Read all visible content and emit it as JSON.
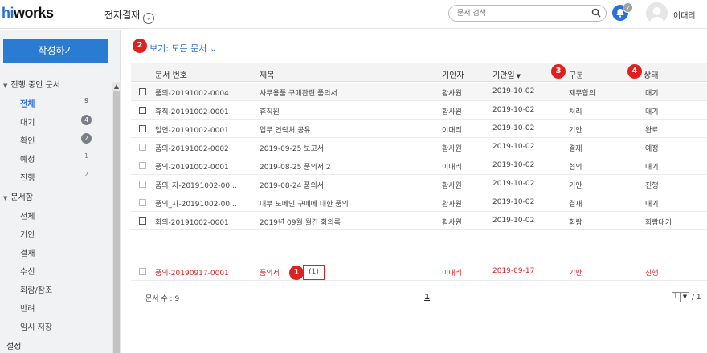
{
  "header": {
    "logo_prefix": "hi",
    "logo_rest": "works",
    "app_title": "전자결재",
    "search_placeholder": "문서 검색",
    "notification_count": "7",
    "user_name": "이대리"
  },
  "sidebar": {
    "write_button": "작성하기",
    "section_inprogress": "진행 중인 문서",
    "inprogress_items": [
      {
        "label": "전체",
        "count": "9"
      },
      {
        "label": "대기",
        "count": "4"
      },
      {
        "label": "확인",
        "count": "2"
      },
      {
        "label": "예정",
        "count": "1"
      },
      {
        "label": "진행",
        "count": "2"
      }
    ],
    "section_box": "문서함",
    "box_items": [
      "전체",
      "기안",
      "결재",
      "수신",
      "회람/참조",
      "반려",
      "임시 저장"
    ],
    "settings": "설정"
  },
  "main": {
    "view_selector": "보기: 모든 문서",
    "columns": {
      "doc_no": "문서 번호",
      "title": "제목",
      "drafter": "기안자",
      "date": "기안일",
      "type": "구분",
      "status": "상태"
    },
    "rows": [
      {
        "doc_no": "품의-20191002-0004",
        "title": "사무용품 구매관련 품의서",
        "drafter": "황사원",
        "date": "2019-10-02",
        "type": "재무합의",
        "status": "대기"
      },
      {
        "doc_no": "휴직-20191002-0001",
        "title": "휴직원",
        "drafter": "황사원",
        "date": "2019-10-02",
        "type": "처리",
        "status": "대기"
      },
      {
        "doc_no": "업연-20191002-0001",
        "title": "업무 연락처 공유",
        "drafter": "이대리",
        "date": "2019-10-02",
        "type": "기안",
        "status": "완료"
      },
      {
        "doc_no": "품의-20191002-0002",
        "title": "2019-09-25 보고서",
        "drafter": "황사원",
        "date": "2019-10-02",
        "type": "결재",
        "status": "예정"
      },
      {
        "doc_no": "품의-20191002-0001",
        "title": "2019-08-25 품의서 2",
        "drafter": "이대리",
        "date": "2019-10-02",
        "type": "협의",
        "status": "대기"
      },
      {
        "doc_no": "품의_자-20191002-00...",
        "title": "2019-08-24 품의서",
        "drafter": "황사원",
        "date": "2019-10-02",
        "type": "기안",
        "status": "진행"
      },
      {
        "doc_no": "품의_자-20191002-00...",
        "title": "내부 도메인 구매에 대한 품의",
        "drafter": "황사원",
        "date": "2019-10-02",
        "type": "결재",
        "status": "대기"
      },
      {
        "doc_no": "회의-20191002-0001",
        "title": "2019년 09월 월간 회의록",
        "drafter": "황사원",
        "date": "2019-10-02",
        "type": "회람",
        "status": "회람대기"
      },
      {
        "doc_no": "품의-20190917-0001",
        "title": "품의서",
        "drafter": "이대리",
        "date": "2019-09-17",
        "type": "기안",
        "status": "진행"
      }
    ],
    "attachment_count": "(1)",
    "markers": [
      "1",
      "2",
      "3",
      "4"
    ],
    "doc_count": "문서 수 : 9",
    "page": "1",
    "page_select": "1",
    "page_total": "/ 1"
  },
  "colors": {
    "accent": "#2a7bd2",
    "marker": "#e02020",
    "link": "#2a6fdb"
  }
}
